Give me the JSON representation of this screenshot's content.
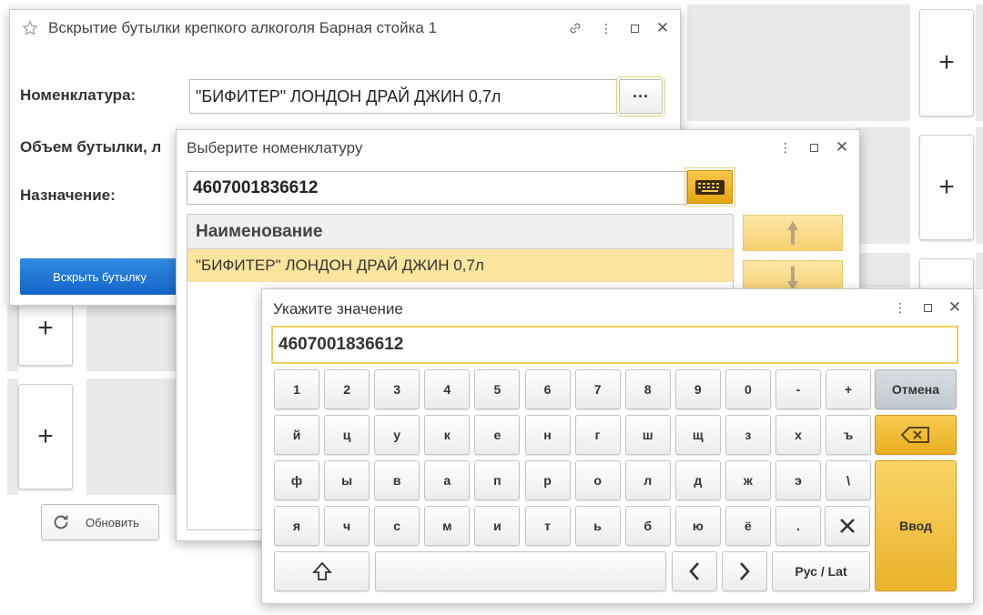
{
  "background": {
    "tiles": [
      "+",
      "+",
      "+",
      "+",
      "+"
    ],
    "refresh_label": "Обновить"
  },
  "window_main": {
    "title": "Вскрытие бутылки крепкого алкоголя Барная стойка 1",
    "labels": {
      "nomenclature": "Номенклатура:",
      "volume": "Объем бутылки, л",
      "purpose": "Назначение:"
    },
    "nomenclature_value": "\"БИФИТЕР\" ЛОНДОН ДРАЙ ДЖИН 0,7л",
    "dots_label": "···",
    "open_button": "Вскрыть бутылку"
  },
  "window_select": {
    "title": "Выберите номенклатуру",
    "search_value": "4607001836612",
    "column_header": "Наименование",
    "rows": [
      "\"БИФИТЕР\" ЛОНДОН ДРАЙ ДЖИН 0,7л"
    ]
  },
  "window_keyboard": {
    "title": "Укажите значение",
    "value": "4607001836612",
    "row1": [
      "1",
      "2",
      "3",
      "4",
      "5",
      "6",
      "7",
      "8",
      "9",
      "0",
      "-",
      "+"
    ],
    "row2": [
      "й",
      "ц",
      "у",
      "к",
      "е",
      "н",
      "г",
      "ш",
      "щ",
      "з",
      "х",
      "ъ"
    ],
    "row3": [
      "ф",
      "ы",
      "в",
      "а",
      "п",
      "р",
      "о",
      "л",
      "д",
      "ж",
      "э",
      "\\"
    ],
    "row4": [
      "я",
      "ч",
      "с",
      "м",
      "и",
      "т",
      "ь",
      "б",
      "ю",
      "ё",
      "."
    ],
    "cancel": "Отмена",
    "enter": "Ввод",
    "lang": "Рус / Lat",
    "accent_color": "#f0cf58"
  }
}
